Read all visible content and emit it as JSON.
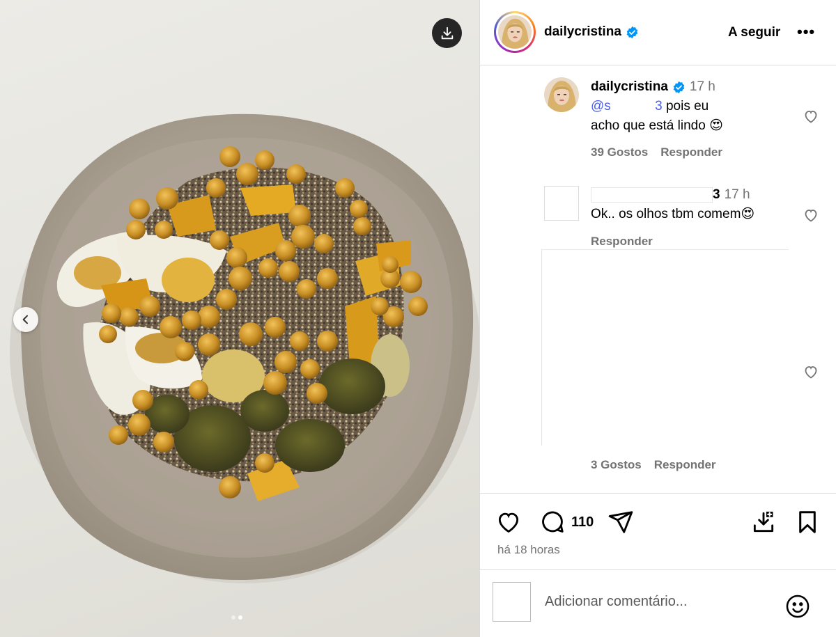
{
  "post": {
    "author": "dailycristina",
    "follow_label": "A seguir",
    "more_label": "•••",
    "comment_count": "110",
    "time_ago": "há 18 horas",
    "carousel": {
      "total": 2,
      "active": 2
    }
  },
  "comments": [
    {
      "username": "dailycristina",
      "time": "17 h",
      "mention": "@s            3",
      "text_line1": " pois eu",
      "text_line2": "acho que está lindo 😍",
      "likes": "39 Gostos",
      "reply": "Responder"
    },
    {
      "username_suffix": "3",
      "time": "17 h",
      "text": "Ok.. os olhos tbm comem😍",
      "reply": "Responder"
    },
    {
      "likes": "3 Gostos",
      "reply": "Responder"
    }
  ],
  "composer": {
    "placeholder": "Adicionar comentário..."
  },
  "icons": {
    "download": "download-icon",
    "prev": "chevron-left-icon",
    "verified": "verified-badge-icon",
    "like": "heart-icon",
    "comment": "comment-icon",
    "share": "paper-plane-icon",
    "save_download": "save-download-icon",
    "bookmark": "bookmark-icon",
    "emoji": "emoji-icon"
  },
  "colors": {
    "verified": "#0095f6",
    "mention": "#4a5de8",
    "muted": "#737373"
  }
}
